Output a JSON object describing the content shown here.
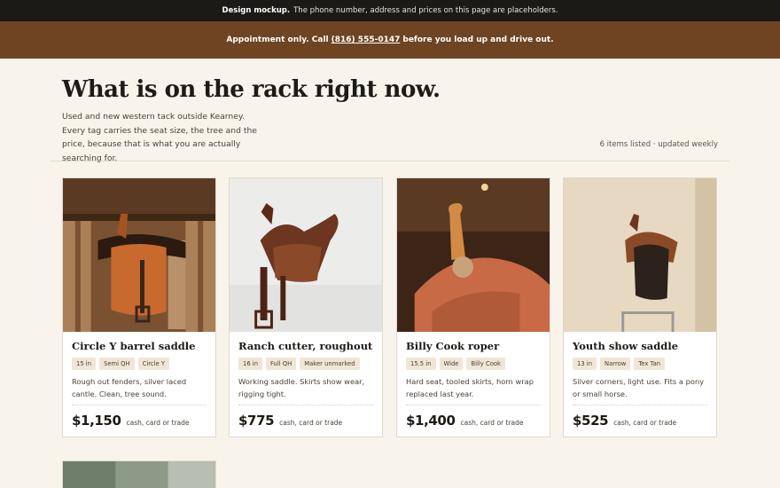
{
  "topbar": {
    "bold": "Design mockup.",
    "text": "The phone number, address and prices on this page are placeholders."
  },
  "appt": {
    "pre": "Appointment only. Call",
    "phone": "(816) 555-0147",
    "post": "before you load up and drive out."
  },
  "hero": {
    "title": "What is on the rack right now.",
    "desc": "Used and new western tack outside Kearney. Every tag carries the seat size, the tree and the price, because that is what you are actually searching for.",
    "meta": "6 items listed · updated weekly"
  },
  "cards": [
    {
      "title": "Circle Y barrel saddle",
      "tags": [
        "15 in",
        "Semi QH",
        "Circle Y"
      ],
      "desc": "Rough out fenders, silver laced cantle. Clean, tree sound.",
      "price": "$1,150",
      "pay": "cash, card or trade"
    },
    {
      "title": "Ranch cutter, roughout",
      "tags": [
        "16 in",
        "Full QH",
        "Maker unmarked"
      ],
      "desc": "Working saddle. Skirts show wear, rigging tight.",
      "price": "$775",
      "pay": "cash, card or trade"
    },
    {
      "title": "Billy Cook roper",
      "tags": [
        "15.5 in",
        "Wide",
        "Billy Cook"
      ],
      "desc": "Hard seat, tooled skirts, horn wrap replaced last year.",
      "price": "$1,400",
      "pay": "cash, card or trade"
    },
    {
      "title": "Youth show saddle",
      "tags": [
        "13 in",
        "Narrow",
        "Tex Tan"
      ],
      "desc": "Silver corners, light use. Fits a pony or small horse.",
      "price": "$525",
      "pay": "cash, card or trade"
    }
  ]
}
